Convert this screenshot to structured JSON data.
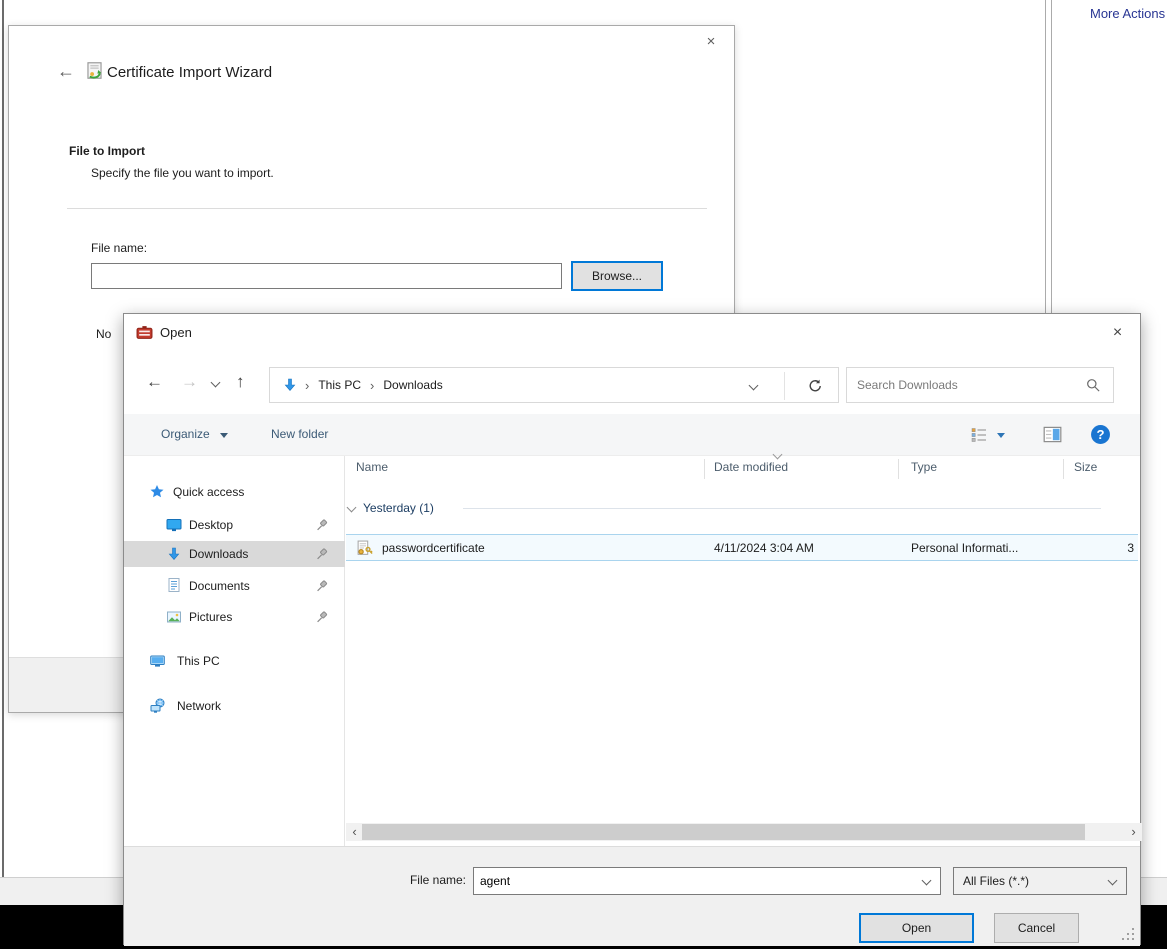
{
  "console": {
    "more_actions": "More Actions"
  },
  "wizard": {
    "title": "Certificate Import Wizard",
    "section_title": "File to Import",
    "section_subtitle": "Specify the file you want to import.",
    "file_name_label": "File name:",
    "file_name_value": "",
    "browse_button": "Browse...",
    "clipped_note": "No"
  },
  "open_dialog": {
    "title": "Open",
    "breadcrumb": {
      "items": [
        "This PC",
        "Downloads"
      ],
      "separator": "›"
    },
    "search": {
      "placeholder": "Search Downloads"
    },
    "toolbar": {
      "organize": "Organize",
      "new_folder": "New folder"
    },
    "sidebar": {
      "items": [
        {
          "label": "Quick access"
        },
        {
          "label": "Desktop",
          "pinned": true
        },
        {
          "label": "Downloads",
          "pinned": true,
          "selected": true
        },
        {
          "label": "Documents",
          "pinned": true
        },
        {
          "label": "Pictures",
          "pinned": true
        },
        {
          "label": "This PC"
        },
        {
          "label": "Network"
        }
      ]
    },
    "columns": [
      "Name",
      "Date modified",
      "Type",
      "Size"
    ],
    "group_label": "Yesterday (1)",
    "files": [
      {
        "name": "passwordcertificate",
        "date_modified": "4/11/2024 3:04 AM",
        "type": "Personal Informati...",
        "size": "3"
      }
    ],
    "footer": {
      "file_name_label": "File name:",
      "file_name_value": "agent",
      "file_type_value": "All Files (*.*)",
      "open_button": "Open",
      "cancel_button": "Cancel"
    }
  },
  "icons": {
    "back": "←",
    "forward": "→",
    "up": "↑",
    "close": "×",
    "scroll_left": "‹",
    "scroll_right": "›"
  },
  "colors": {
    "accent": "#0078d7",
    "selected_row_border": "#a9d4ee",
    "selected_row_bg": "#f3fafe",
    "sidebar_selected_bg": "#d9d9d9",
    "more_actions_text": "#283593"
  }
}
